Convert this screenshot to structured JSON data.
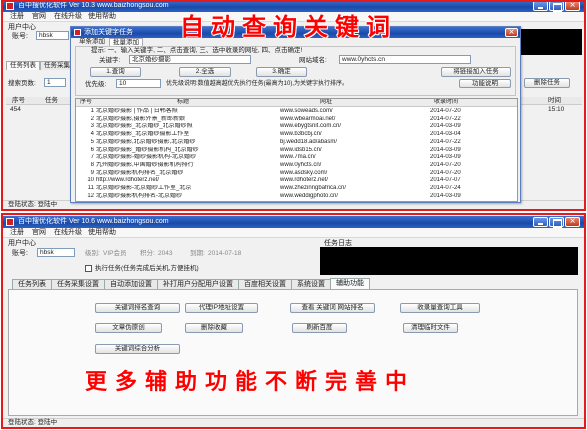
{
  "colors": {
    "accent_red": "#ff0000",
    "frame_red": "#e41b1b",
    "title_bar_light": "#3a6fd0",
    "title_bar_dark": "#1a4aa8"
  },
  "top": {
    "title": "百中搜优化软件 Ver 10.3 www.baizhongsou.com",
    "menu": [
      "注册",
      "官网",
      "在线升级",
      "使用帮助"
    ],
    "user_center": "用户中心",
    "account_label": "账号:",
    "account_value": "hbsk",
    "banner": "自动查询关键词",
    "tabs": [
      "任务列表",
      "任务采集设置"
    ],
    "search_pages_label": "搜索页数:",
    "search_pages_value": "1",
    "task_table": {
      "columns": [
        "序号",
        "任务",
        "时间"
      ],
      "row": {
        "no": "454",
        "time": "15:10"
      }
    },
    "delete_task": "删除任务",
    "status": "登陆状态: 登陆中",
    "dialog": {
      "title": "添加关键字任务",
      "tabs": [
        "单条添加",
        "批量添加"
      ],
      "hint": "提示: 一、输入关键字, 二、点击查询, 三、选中收录的网址, 四、点击确定!",
      "keyword_label": "关键字:",
      "keyword_value": "北京婚纱摄影",
      "domain_label": "网站域名:",
      "domain_value": "www.0yhcts.cn",
      "buttons": {
        "query": "1.查询",
        "select_all": "2.全选",
        "confirm": "3.确定",
        "add_link": "将链接加入任务"
      },
      "priority_label": "优先级:",
      "priority_value": "10",
      "priority_desc": "优先级说明:数值越高越优先执行任务(最高为10),为关键字执行排序。",
      "help": "功能说明",
      "table": {
        "columns": [
          "序号",
          "标题",
          "网址",
          "收录时间"
        ],
        "rows": [
          {
            "no": "1",
            "title": "北京婚纱摄影 | 作品 | 日韩客照",
            "url": "www.soweads.com/",
            "date": "2014-07-20"
          },
          {
            "no": "2",
            "title": "北京婚纱摄影,摄影外景_新郎新娘",
            "url": "www.wbearmoai.net/",
            "date": "2014-07-22"
          },
          {
            "no": "3",
            "title": "北京婚纱摄影_北京婚纱_北京婚纱照",
            "url": "www.ebygtsnit.com.cn/",
            "date": "2014-03-09"
          },
          {
            "no": "4",
            "title": "北京婚纱摄影_北京婚纱摄影工作室",
            "url": "www.b3bcbj.cn/",
            "date": "2014-03-04"
          },
          {
            "no": "5",
            "title": "北京婚纱摄影,北京婚纱摄影,北京婚纱",
            "url": "bj.wedd18.ad/abasm/",
            "date": "2014-07-22"
          },
          {
            "no": "6",
            "title": "北京婚纱摄影_婚纱摄影机构_北京婚纱",
            "url": "www.idsb15.cn/",
            "date": "2014-03-09"
          },
          {
            "no": "7",
            "title": "北京婚纱摄影-婚纱摄影机构-北京婚纱",
            "url": "www.7ma.cn/",
            "date": "2014-03-09"
          },
          {
            "no": "8",
            "title": "九州婚纱摄影,中国婚纱摄影机构排行",
            "url": "www.0yhcts.cn/",
            "date": "2014-07-20"
          },
          {
            "no": "9",
            "title": "北京婚纱摄影机构排名_北京婚纱",
            "url": "www.asdsky.com/",
            "date": "2014-07-20"
          },
          {
            "no": "10",
            "title": "http://www.rdhoterz.net/",
            "url": "www.rdhoterz.net/",
            "date": "2014-07-07"
          },
          {
            "no": "11",
            "title": "北京婚纱摄影-北京婚纱工作室_北京",
            "url": "www.zhezinngbafrica.cn/",
            "date": "2014-07-24"
          },
          {
            "no": "12",
            "title": "北京婚纱摄影机构排名-北京婚纱",
            "url": "www.weddigphoto.cn/",
            "date": "2014-03-09"
          }
        ]
      }
    }
  },
  "bottom": {
    "title": "百中搜优化软件 Ver 10.6 www.baizhongsou.com",
    "menu": [
      "注册",
      "官网",
      "在线升级",
      "使用帮助"
    ],
    "user_center": "用户中心",
    "task_log": "任务日志",
    "account_label": "账号:",
    "account_value": "hbsk",
    "level_label": "级别:",
    "level_value": "VIP会员",
    "points_label": "积分:",
    "points_value": "2043",
    "expire_label": "到期:",
    "expire_value": "2014-07-18",
    "auto_shutdown": "执行任务(任务完成后关机,方便挂机)",
    "auto_shutdown_checked": false,
    "tabs": [
      "任务列表",
      "任务采集设置",
      "自动添加设置",
      "补打用户分配用户设置",
      "百度相关设置",
      "系统设置",
      "辅助功能"
    ],
    "active_tab_index": 6,
    "tools": {
      "row1": [
        "关键词排名查询",
        "代理IP地址设置",
        "查看 关键词 网站排名",
        "收录量查询工具"
      ],
      "row2": [
        "文章伪原创",
        "删除收藏",
        "刷新百度",
        "清理临时文件"
      ],
      "row3": [
        "关键词综合分析"
      ]
    },
    "banner": "更多辅助功能不断完善中",
    "status": "登陆状态: 登陆中"
  }
}
